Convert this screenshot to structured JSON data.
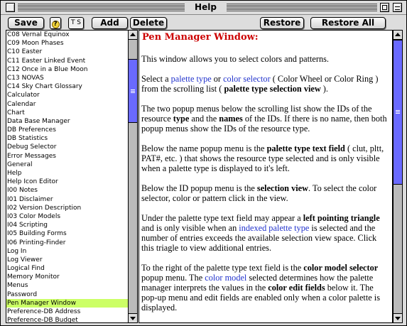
{
  "window": {
    "title": "Help"
  },
  "toolbar": {
    "save": "Save",
    "help_icon": "?",
    "ts": "T S",
    "add": "Add",
    "delete": "Delete",
    "restore": "Restore",
    "restore_all": "Restore All"
  },
  "list": {
    "selected_index": 34,
    "items": [
      "C08 Vernal Equinox",
      "C09 Moon Phases",
      "C10 Easter",
      "C11 Easter Linked Event",
      "C12 Once in a Blue Moon",
      "C13 NOVAS",
      "C14 Sky Chart Glossary",
      "Calculator",
      "Calendar",
      "Chart",
      "Data Base Manager",
      "DB Preferences",
      "DB Statistics",
      "Debug Selector",
      "Error Messages",
      "General",
      "Help",
      "Help Icon Editor",
      "I00 Notes",
      "I01 Disclaimer",
      "I02 Version Description",
      "I03 Color Models",
      "I04 Scripting",
      "I05 Building Forms",
      "I06 Printing-Finder",
      "Log In",
      "Log Viewer",
      "Logical Find",
      "Memory Monitor",
      "Menus",
      "Password",
      "Pen Manager Window",
      "Preference-DB Address",
      "Preference-DB Budget"
    ],
    "selected_label": "Pen Manager Window"
  },
  "content": {
    "title": "Pen Manager Window:",
    "p1": "This window allows you to select colors and patterns.",
    "p2": {
      "a": "Select a ",
      "link1": "palette type",
      "b": " or ",
      "link2": "color selector",
      "c": " ( Color Wheel or Color Ring ) from the scrolling list ( ",
      "bold1": "palette type selection view",
      "d": " )."
    },
    "p3": {
      "a": "The two popup menus below the scrolling list show the IDs of the resource ",
      "bold1": "type",
      "b": " and the ",
      "bold2": "names",
      "c": " of the IDs. If there is no name, then both popup menus show the IDs of the resource type."
    },
    "p4": {
      "a": "Below the name popup menu is the ",
      "bold1": "palette type text field",
      "b": " ( clut, pltt, PAT#, etc. ) that shows the resource type selected and is only visible when a palette type is displayed to it's left."
    },
    "p5": {
      "a": "Below the ID popup menu is the ",
      "bold1": "selection view",
      "b": ". To select the color selector, color or pattern click in the view."
    },
    "p6": {
      "a": "Under the palette type text field may appear a ",
      "bold1": "left pointing triangle",
      "b": " and is only visible when an ",
      "link1": "indexed palette type",
      "c": " is selected and the number of entries exceeds the available selection view space. Click this triagle to view additional entries."
    },
    "p7": {
      "a": "To the right of the palette type text field is the ",
      "bold1": "color model selector",
      "b": " popup menu. The ",
      "link1": "color model",
      "c": " selected determines how the palette manager interprets the values in the ",
      "bold2": "color edit fields",
      "d": " below it. The pop-up menu and edit fields are enabled only when a color palette is displayed."
    }
  },
  "colors": {
    "title_red": "#cc0000",
    "link_blue": "#2233cc",
    "selection_green": "#ccff66",
    "scroll_thumb": "#6a6aff"
  },
  "icons": [
    "close-box-icon",
    "zoom-box-icon",
    "windowshade-box-icon",
    "help-balloon-icon",
    "scroll-up-arrow-icon",
    "scroll-down-arrow-icon"
  ]
}
